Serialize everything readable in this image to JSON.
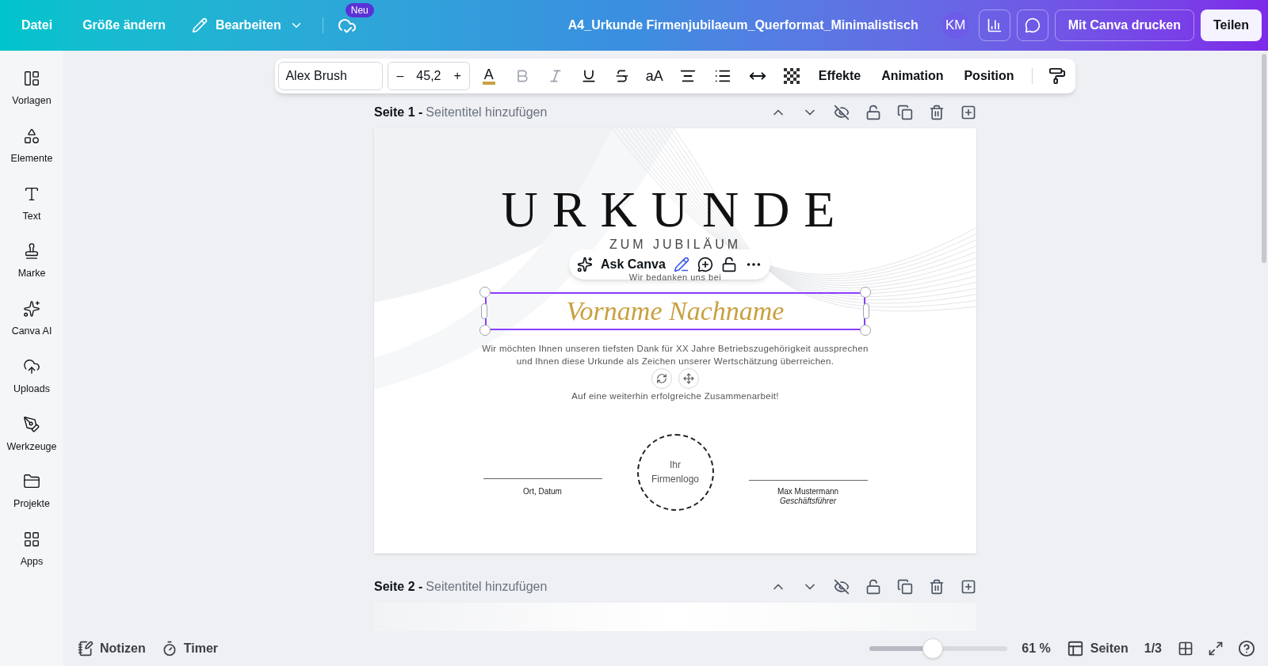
{
  "topbar": {
    "menu": [
      "Datei",
      "Größe ändern"
    ],
    "edit_menu": "Bearbeiten",
    "badge": "Neu",
    "title": "A4_Urkunde Firmenjubilaeum_Querformat_Minimalistisch",
    "avatar": "KM",
    "print_button": "Mit Canva drucken",
    "share_button": "Teilen"
  },
  "sidebar": [
    {
      "label": "Vorlagen"
    },
    {
      "label": "Elemente"
    },
    {
      "label": "Text"
    },
    {
      "label": "Marke"
    },
    {
      "label": "Canva AI"
    },
    {
      "label": "Uploads"
    },
    {
      "label": "Werkzeuge"
    },
    {
      "label": "Projekte"
    },
    {
      "label": "Apps"
    }
  ],
  "text_toolbar": {
    "font": "Alex Brush",
    "minus": "–",
    "size": "45,2",
    "plus": "+",
    "color_letter": "A",
    "case_label": "aA",
    "buttons": [
      "Effekte",
      "Animation",
      "Position"
    ]
  },
  "pages": [
    {
      "label": "Seite 1 -",
      "title_placeholder": "Seitentitel hinzufügen"
    },
    {
      "label": "Seite 2 -",
      "title_placeholder": "Seitentitel hinzufügen"
    }
  ],
  "certificate": {
    "title": "URKUNDE",
    "subtitle": "ZUM JUBILÄUM",
    "intro": "Wir bedanken uns bei",
    "name": "Vorname Nachname",
    "body": [
      "Wir möchten Ihnen unseren tiefsten Dank für XX Jahre Betriebszugehörigkeit aussprechen",
      "und Ihnen diese Urkunde als Zeichen unserer Wertschätzung überreichen."
    ],
    "closing": "Auf eine weiterhin erfolgreiche Zusammenarbeit!",
    "left_signature": "Ort, Datum",
    "logo": [
      "Ihr",
      "Firmenlogo"
    ],
    "right_signature": "Max Mustermann",
    "right_role": "Geschäftsführer"
  },
  "context_menu": {
    "label": "Ask Canva"
  },
  "footer": {
    "notes": "Notizen",
    "timer": "Timer",
    "zoom": {
      "level": 0.46
    },
    "zoom_reading": "61 %",
    "pages_button": "Seiten",
    "page_count": "1/3"
  }
}
